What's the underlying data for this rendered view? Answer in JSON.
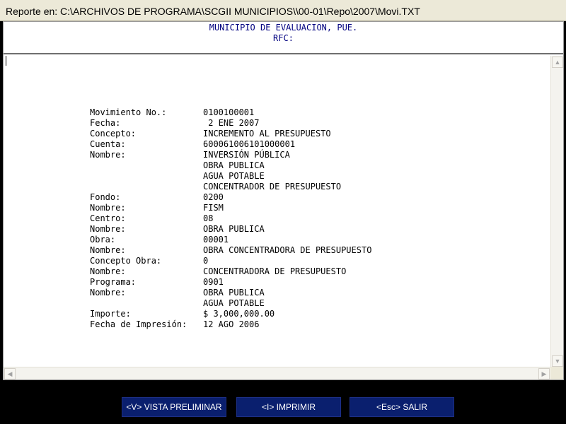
{
  "window": {
    "title": "Reporte en: C:\\ARCHIVOS DE PROGRAMA\\SCGII MUNICIPIOS\\\\00-01\\Repo\\2007\\Movi.TXT"
  },
  "header": {
    "line1": "MUNICIPIO DE EVALUACION, PUE.",
    "line2": "RFC:"
  },
  "report": {
    "rows": [
      {
        "label": "Movimiento No.:",
        "value": "0100100001"
      },
      {
        "label": "Fecha:",
        "value": " 2 ENE 2007"
      },
      {
        "label": "Concepto:",
        "value": "INCREMENTO AL PRESUPUESTO"
      },
      {
        "label": "Cuenta:",
        "value": "600061006101000001"
      },
      {
        "label": "Nombre:",
        "value": "INVERSIÓN PÚBLICA"
      },
      {
        "label": "",
        "value": "OBRA PUBLICA"
      },
      {
        "label": "",
        "value": "AGUA POTABLE"
      },
      {
        "label": "",
        "value": "CONCENTRADOR DE PRESUPUESTO"
      },
      {
        "label": "Fondo:",
        "value": "0200"
      },
      {
        "label": "Nombre:",
        "value": "FISM"
      },
      {
        "label": "Centro:",
        "value": "08"
      },
      {
        "label": "Nombre:",
        "value": "OBRA PUBLICA"
      },
      {
        "label": "Obra:",
        "value": "00001"
      },
      {
        "label": "Nombre:",
        "value": "OBRA CONCENTRADORA DE PRESUPUESTO"
      },
      {
        "label": "Concepto Obra:",
        "value": "0"
      },
      {
        "label": "Nombre:",
        "value": "CONCENTRADORA DE PRESUPUESTO"
      },
      {
        "label": "Programa:",
        "value": "0901"
      },
      {
        "label": "Nombre:",
        "value": "OBRA PUBLICA"
      },
      {
        "label": "",
        "value": "AGUA POTABLE"
      },
      {
        "label": "Importe:",
        "value": "$ 3,000,000.00"
      },
      {
        "label": "Fecha de Impresión:",
        "value": "12 AGO 2006"
      }
    ]
  },
  "footer": {
    "preview_label": "<V> VISTA PRELIMINAR",
    "print_label": "<I> IMPRIMIR",
    "exit_label": "<Esc> SALIR"
  },
  "colors": {
    "header_text": "#000080",
    "button_bg": "#0a1f6e",
    "footer_bg": "#000000"
  },
  "icons": {
    "scroll_up": "scroll-up-arrow-icon",
    "scroll_down": "scroll-down-arrow-icon",
    "scroll_left": "scroll-left-arrow-icon",
    "scroll_right": "scroll-right-arrow-icon"
  }
}
